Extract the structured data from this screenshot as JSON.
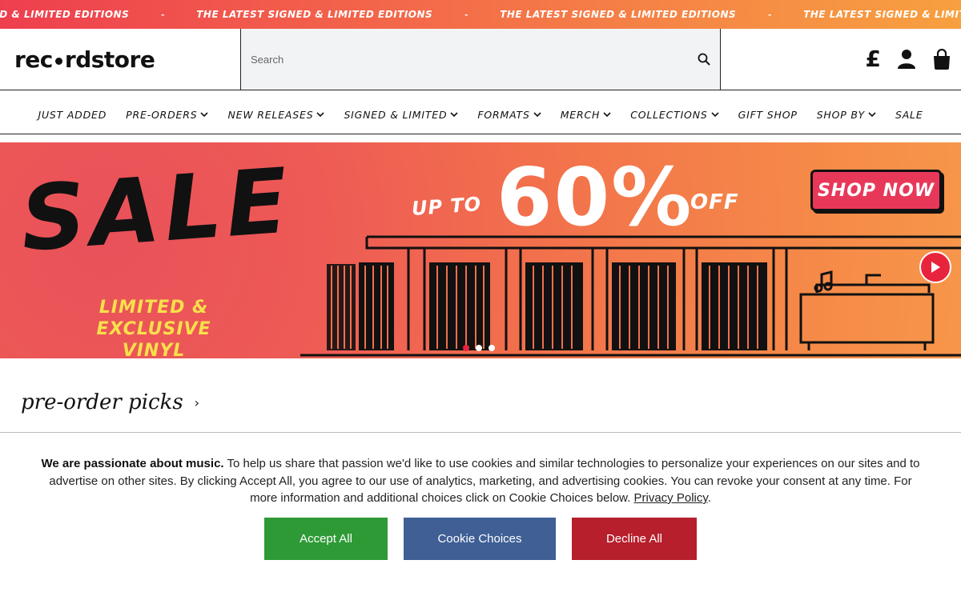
{
  "ticker": {
    "items": [
      "NED & LIMITED EDITIONS",
      "THE LATEST SIGNED & LIMITED EDITIONS",
      "THE LATEST SIGNED & LIMITED EDITIONS",
      "THE LATEST SIGNED & LIMITED EDITIONS"
    ],
    "separator": "-"
  },
  "header": {
    "logo_left": "rec",
    "logo_right": "rdstore",
    "search_placeholder": "Search",
    "currency_symbol": "£",
    "icons": [
      "search-icon",
      "currency-icon",
      "account-icon",
      "bag-icon"
    ]
  },
  "nav": {
    "items": [
      {
        "label": "Just Added",
        "dropdown": false
      },
      {
        "label": "Pre-Orders",
        "dropdown": true
      },
      {
        "label": "New Releases",
        "dropdown": true
      },
      {
        "label": "Signed & Limited",
        "dropdown": true
      },
      {
        "label": "Formats",
        "dropdown": true
      },
      {
        "label": "Merch",
        "dropdown": true
      },
      {
        "label": "Collections",
        "dropdown": true
      },
      {
        "label": "Gift Shop",
        "dropdown": false
      },
      {
        "label": "Shop By",
        "dropdown": true
      },
      {
        "label": "Sale",
        "dropdown": false
      }
    ]
  },
  "hero": {
    "headline": "SALE",
    "sub_line1": "LIMITED &",
    "sub_line2": "EXCLUSIVE VINYL",
    "upto": "UP TO",
    "percent": "60%",
    "off": "OFF",
    "cta": "SHOP NOW",
    "slides": 3,
    "active_slide": 1,
    "colors": {
      "accent": "#e8243d",
      "gold": "#f8e04b"
    }
  },
  "section": {
    "title": "pre-order picks",
    "chevron": "›"
  },
  "cookie": {
    "bold": "We are passionate about music.",
    "text": " To help us share that passion we'd like to use cookies and similar technologies to personalize your experiences on our sites and to advertise on other sites. By clicking Accept All, you agree to our use of analytics, marketing, and advertising cookies. You can revoke your consent at any time. For more information and additional choices click on Cookie Choices below. ",
    "link": "Privacy Policy",
    "end": ".",
    "accept": "Accept All",
    "choices": "Cookie Choices",
    "decline": "Decline All",
    "colors": {
      "accept": "#2e9a36",
      "choices": "#3f5f95",
      "decline": "#b61f2b"
    }
  }
}
